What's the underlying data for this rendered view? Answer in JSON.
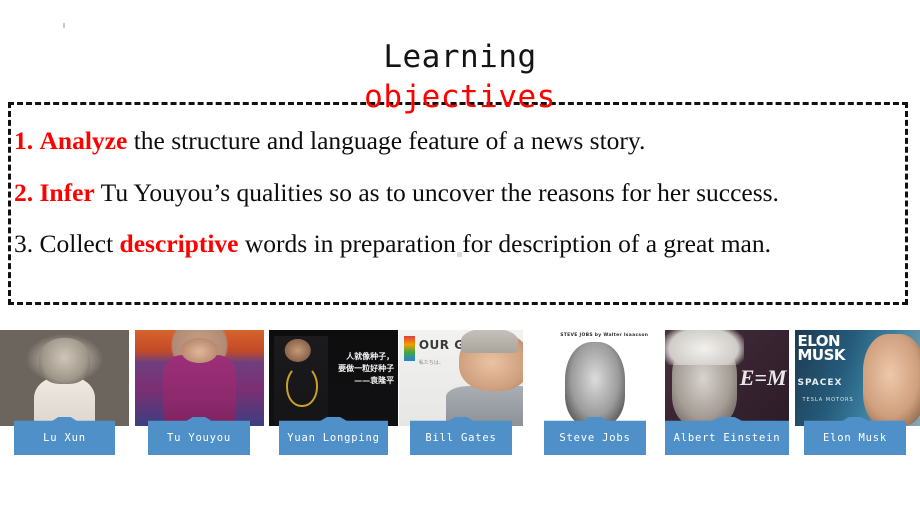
{
  "slide": {
    "title_line_1": "Learning",
    "title_line_2": "objectives",
    "title_color_1": "#141414",
    "title_color_2": "#ff0000",
    "accent_red": "#ff0000",
    "banner_blue": "#4f90c9",
    "border_style": "dashed black 3px"
  },
  "objectives": [
    {
      "number": "1.",
      "number_color": "red",
      "keyword": "Analyze",
      "keyword_color": "red",
      "rest": " the structure and language feature of a news story.",
      "full_text": "1. Analyze the structure and language feature of a news story."
    },
    {
      "number": "2.",
      "number_color": "red",
      "keyword": "Infer",
      "keyword_color": "red",
      "rest": " Tu Youyou’s qualities so as to uncover the reasons for her success.",
      "full_text": "2. Infer Tu Youyou’s qualities so as to uncover the reasons for her success."
    },
    {
      "number": "3.",
      "number_color": "black",
      "lead": " Collect ",
      "keyword": "descriptive",
      "keyword_color": "red",
      "rest": " words in preparation for description of a great man.",
      "full_text": "3. Collect descriptive words in preparation for description of a great man."
    }
  ],
  "people": [
    {
      "name": "Lu  Xun",
      "photo_kind": "portrait-bw",
      "caption_overlay": ""
    },
    {
      "name": "Tu  Youyou",
      "photo_kind": "portrait-color",
      "caption_overlay": ""
    },
    {
      "name": "Yuan Longping",
      "photo_kind": "portrait-dark-quote",
      "caption_overlay": "人就像种子，\n要做一粒好种子\n——袁隆平"
    },
    {
      "name": "Bill Gates",
      "photo_kind": "press-conference",
      "caption_overlay": "OUR G",
      "caption_sub": "私たちは、"
    },
    {
      "name": "Steve Jobs",
      "photo_kind": "book-cover",
      "caption_overlay": "STEVE JOBS by Walter Isaacson"
    },
    {
      "name": "Albert Einstein",
      "photo_kind": "portrait-equation",
      "caption_overlay": "E=M"
    },
    {
      "name": "Elon Musk",
      "photo_kind": "magazine-cover",
      "caption_overlay": "ELON\nMUSK",
      "caption_sub": "SPACEX",
      "caption_sub2": "TESLA MOTORS"
    }
  ]
}
